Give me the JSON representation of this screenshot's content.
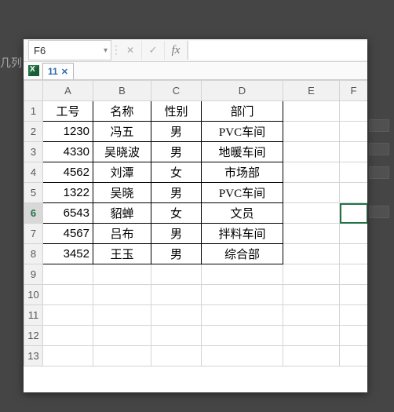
{
  "background_label": "几列",
  "name_box": {
    "value": "F6"
  },
  "fx_label": "fx",
  "sheet_tab": {
    "label": "11"
  },
  "columns": [
    "A",
    "B",
    "C",
    "D",
    "E",
    "F"
  ],
  "row_numbers": [
    1,
    2,
    3,
    4,
    5,
    6,
    7,
    8,
    9,
    10,
    11,
    12,
    13
  ],
  "selected_row": 6,
  "active_cell": {
    "row": 6,
    "col": "F"
  },
  "headers": {
    "A": "工号",
    "B": "名称",
    "C": "性别",
    "D": "部门"
  },
  "rows": [
    {
      "A": "1230",
      "B": "冯五",
      "C": "男",
      "D": "PVC车间"
    },
    {
      "A": "4330",
      "B": "吴晓波",
      "C": "男",
      "D": "地暖车间"
    },
    {
      "A": "4562",
      "B": "刘潭",
      "C": "女",
      "D": "市场部"
    },
    {
      "A": "1322",
      "B": "吴晓",
      "C": "男",
      "D": "PVC车间"
    },
    {
      "A": "6543",
      "B": "貂蝉",
      "C": "女",
      "D": "文员"
    },
    {
      "A": "4567",
      "B": "吕布",
      "C": "男",
      "D": "拌料车间"
    },
    {
      "A": "3452",
      "B": "王玉",
      "C": "男",
      "D": "综合部"
    }
  ]
}
